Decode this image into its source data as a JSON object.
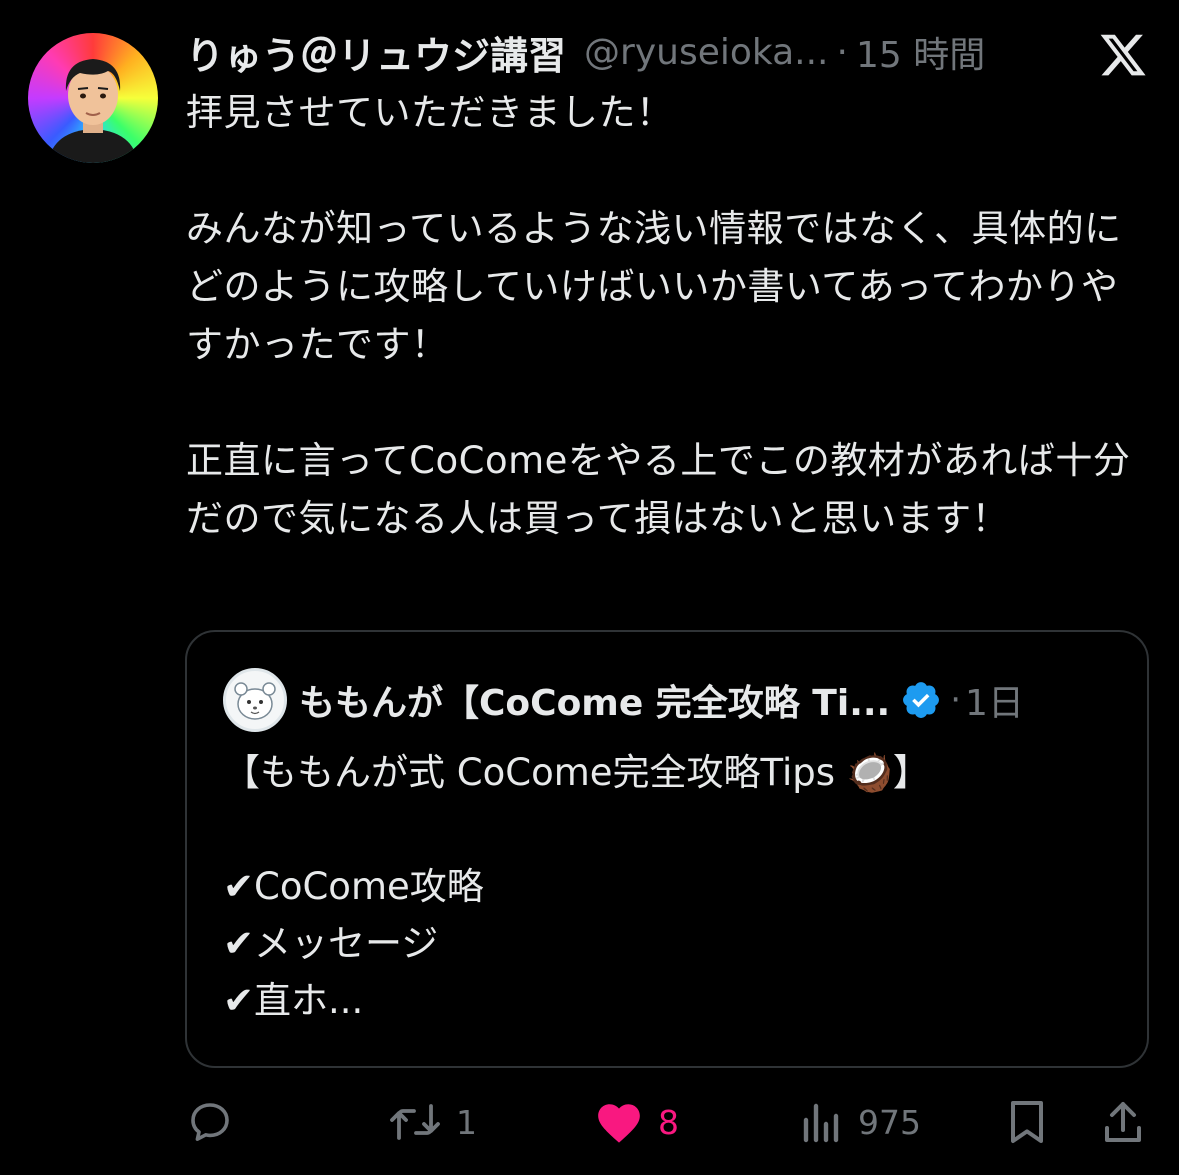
{
  "author": {
    "display_name": "りゅう＠リュウジ講習",
    "handle": "@ryuseioka...",
    "separator": "·",
    "time": "15 時間"
  },
  "tweet": {
    "text": "拝見させていただきました！\n\nみんなが知っているような浅い情報ではなく、具体的にどのように攻略していけばいいか書いてあってわかりやすかったです！\n\n正直に言ってCoComeをやる上でこの教材があれば十分だので気になる人は買って損はないと思います！"
  },
  "quoted_tweet": {
    "display_name": "ももんが【CoCome 完全攻略 Ti...",
    "verified": true,
    "separator": "·",
    "time": "1日",
    "text": "【ももんが式 CoCome完全攻略Tips 🥥】\n\n✔CoCome攻略\n✔メッセージ\n✔直ホ..."
  },
  "actions": {
    "reply": {
      "icon": "reply-icon",
      "count": ""
    },
    "retweet": {
      "icon": "retweet-icon",
      "count": "1"
    },
    "like": {
      "icon": "heart-icon",
      "count": "8",
      "liked": true
    },
    "views": {
      "icon": "views-icon",
      "count": "975"
    },
    "bookmark": {
      "icon": "bookmark-icon"
    },
    "share": {
      "icon": "share-icon"
    }
  },
  "colors": {
    "background": "#000000",
    "text": "#e7e9ea",
    "muted": "#71767b",
    "border": "#2f3336",
    "like": "#f91880",
    "verified": "#1d9bf0"
  }
}
